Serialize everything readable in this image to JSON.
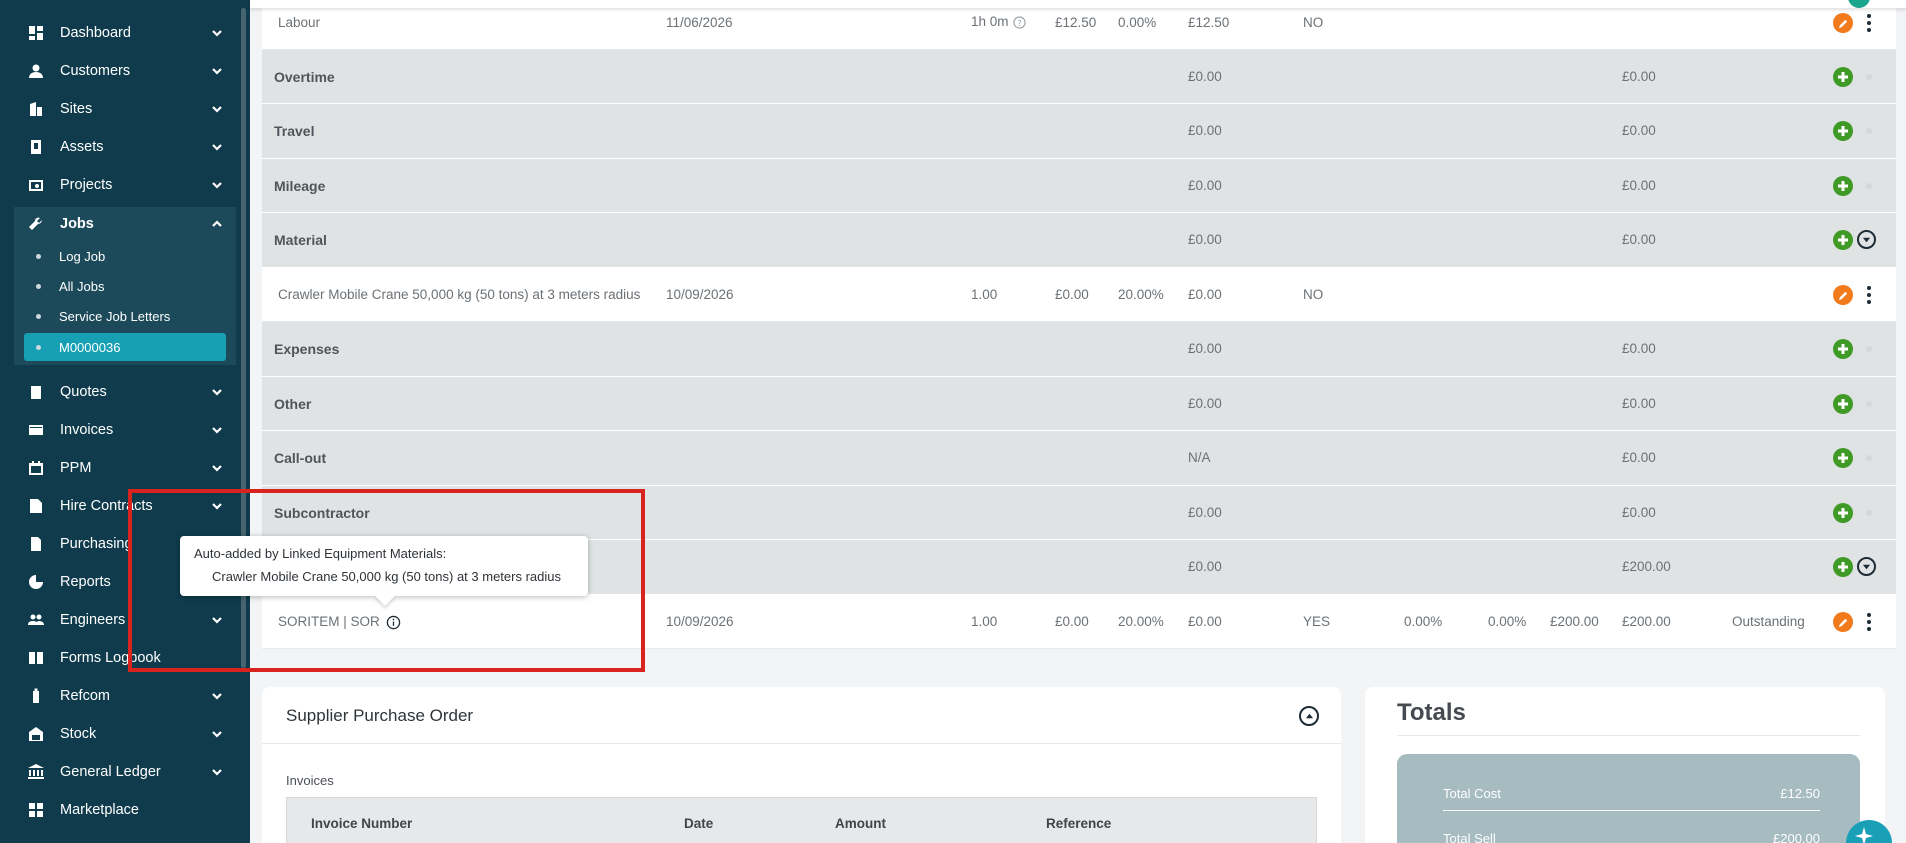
{
  "sidebar": {
    "items": [
      {
        "label": "Dashboard",
        "icon": "dashboard-icon"
      },
      {
        "label": "Customers",
        "icon": "person-icon"
      },
      {
        "label": "Sites",
        "icon": "building-icon"
      },
      {
        "label": "Assets",
        "icon": "asset-icon"
      },
      {
        "label": "Projects",
        "icon": "projects-icon"
      },
      {
        "label": "Jobs",
        "icon": "wrench-icon"
      },
      {
        "label": "Quotes",
        "icon": "clipboard-icon"
      },
      {
        "label": "Invoices",
        "icon": "card-icon"
      },
      {
        "label": "PPM",
        "icon": "calendar-icon"
      },
      {
        "label": "Hire Contracts",
        "icon": "contract-icon"
      },
      {
        "label": "Purchasing",
        "icon": "document-icon"
      },
      {
        "label": "Reports",
        "icon": "pie-chart-icon"
      },
      {
        "label": "Engineers",
        "icon": "group-icon"
      },
      {
        "label": "Forms Logbook",
        "icon": "book-icon"
      },
      {
        "label": "Refcom",
        "icon": "cylinder-icon"
      },
      {
        "label": "Stock",
        "icon": "warehouse-icon"
      },
      {
        "label": "General Ledger",
        "icon": "bank-icon"
      },
      {
        "label": "Marketplace",
        "icon": "grid-icon"
      }
    ],
    "jobs_sub": [
      "Log Job",
      "All Jobs",
      "Service Job Letters",
      "M0000036"
    ]
  },
  "table": {
    "labour_row": {
      "name": "Labour",
      "date": "11/06/2026",
      "qty": "1h 0m",
      "rate": "£12.50",
      "discount": "0.00%",
      "total": "£12.50",
      "flag": "NO"
    },
    "sections": [
      {
        "label": "Overtime",
        "cost": "£0.00",
        "sell": "£0.00"
      },
      {
        "label": "Travel",
        "cost": "£0.00",
        "sell": "£0.00"
      },
      {
        "label": "Mileage",
        "cost": "£0.00",
        "sell": "£0.00"
      },
      {
        "label": "Material",
        "cost": "£0.00",
        "sell": "£0.00"
      }
    ],
    "material_row": {
      "name": "Crawler Mobile Crane 50,000 kg (50 tons) at 3 meters radius",
      "date": "10/09/2026",
      "qty": "1.00",
      "rate": "£0.00",
      "discount": "20.00%",
      "total": "£0.00",
      "flag": "NO"
    },
    "sections2": [
      {
        "label": "Expenses",
        "cost": "£0.00",
        "sell": "£0.00"
      },
      {
        "label": "Other",
        "cost": "£0.00",
        "sell": "£0.00"
      },
      {
        "label": "Call-out",
        "cost": "N/A",
        "sell": "£0.00"
      },
      {
        "label": "Subcontractor",
        "cost": "£0.00",
        "sell": "£0.00"
      },
      {
        "label": "",
        "cost": "£0.00",
        "sell": "£200.00"
      }
    ],
    "sor_row": {
      "name": "SORITEM | SOR",
      "date": "10/09/2026",
      "qty": "1.00",
      "rate": "£0.00",
      "discount": "20.00%",
      "total": "£0.00",
      "flag": "YES",
      "p1": "0.00%",
      "p2": "0.00%",
      "a1": "£200.00",
      "a2": "£200.00",
      "status": "Outstanding"
    }
  },
  "tooltip": {
    "line1": "Auto-added by Linked Equipment Materials:",
    "line2": "Crawler Mobile Crane 50,000 kg (50 tons) at 3 meters radius"
  },
  "supplier_po": {
    "title": "Supplier Purchase Order",
    "invoices_label": "Invoices",
    "columns": [
      "Invoice Number",
      "Date",
      "Amount",
      "Reference"
    ]
  },
  "totals": {
    "title": "Totals",
    "total_cost_label": "Total Cost",
    "total_cost": "£12.50",
    "total_sell_label": "Total Sell",
    "total_sell": "£200.00"
  },
  "colors": {
    "sidebar_bg": "#0f3b4c",
    "active_item": "#17a0b4",
    "add_button": "#3f9a26",
    "edit_button": "#f17a1d",
    "highlight": "#d8231f"
  }
}
